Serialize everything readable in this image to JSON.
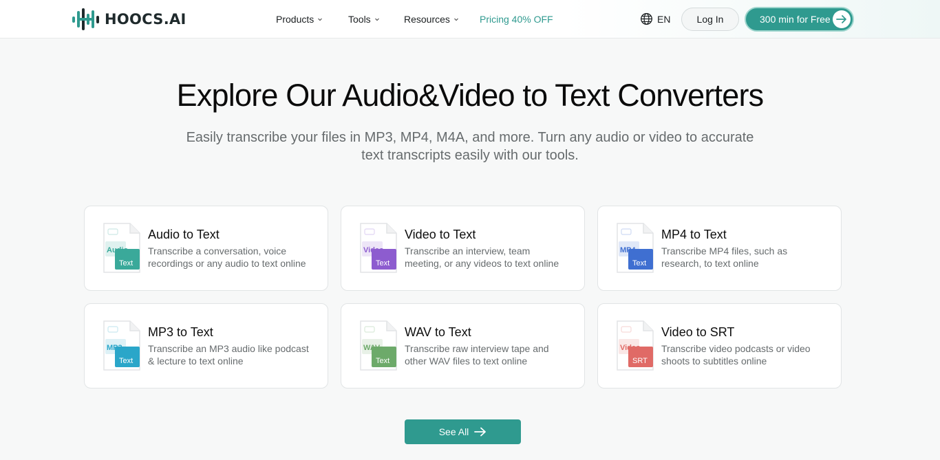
{
  "header": {
    "brand": "HOOCS.AI",
    "nav": {
      "products": "Products",
      "tools": "Tools",
      "resources": "Resources",
      "pricing": "Pricing 40% OFF"
    },
    "language": "EN",
    "login": "Log In",
    "cta": "300 min for Free"
  },
  "hero": {
    "title": "Explore Our Audio&Video to Text Converters",
    "subtitle_line1": "Easily transcribe your files in MP3, MP4, M4A, and more. Turn any audio or video to accurate",
    "subtitle_line2": "text transcripts easily with our tools."
  },
  "cards": [
    {
      "title": "Audio to Text",
      "desc_line1": "Transcribe a conversation, voice",
      "desc_line2": "recordings or any audio to text online",
      "icon_top": "Audio",
      "icon_bottom": "Text",
      "color": "#3aa99a"
    },
    {
      "title": "Video to Text",
      "desc_line1": "Transcribe an interview, team",
      "desc_line2": "meeting, or any videos to text online",
      "icon_top": "Video",
      "icon_bottom": "Text",
      "color": "#8d5ccf"
    },
    {
      "title": "MP4 to Text",
      "desc_line1": "Transcribe MP4 files, such as",
      "desc_line2": "research, to text online",
      "icon_top": "MP4",
      "icon_bottom": "Text",
      "color": "#3f6fd1"
    },
    {
      "title": "MP3 to Text",
      "desc_line1": "Transcribe an MP3 audio like podcast",
      "desc_line2": "& lecture to text online",
      "icon_top": "MP3",
      "icon_bottom": "Text",
      "color": "#2aa6c9"
    },
    {
      "title": "WAV to Text",
      "desc_line1": "Transcribe raw interview tape and",
      "desc_line2": "other WAV files to text online",
      "icon_top": "WAV",
      "icon_bottom": "Text",
      "color": "#6daa6a"
    },
    {
      "title": "Video to SRT",
      "desc_line1": "Transcribe video podcasts or video",
      "desc_line2": "shoots to subtitles online",
      "icon_top": "Video",
      "icon_bottom": "SRT",
      "color": "#e06a66"
    }
  ],
  "see_all": "See All",
  "colors": {
    "accent": "#2f9a8f"
  }
}
